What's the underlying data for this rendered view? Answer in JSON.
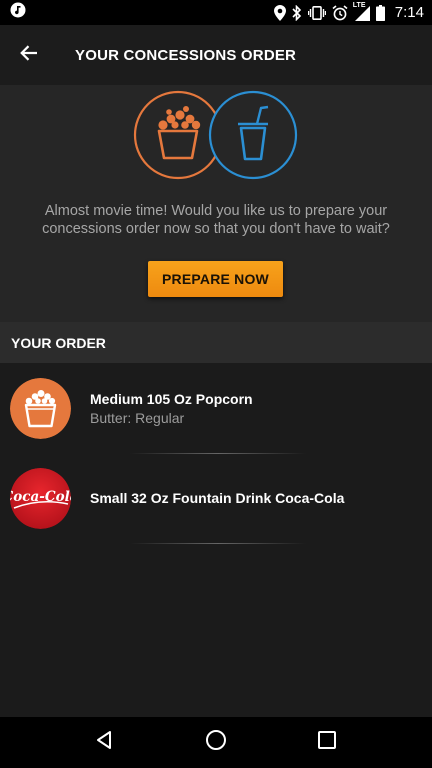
{
  "status_bar": {
    "time": "7:14",
    "network_label": "LTE",
    "icons": [
      "music-note-icon",
      "location-icon",
      "bluetooth-icon",
      "vibrate-icon",
      "alarm-icon",
      "signal-icon",
      "battery-icon"
    ]
  },
  "app_bar": {
    "back_icon": "arrow-back-icon",
    "title": "YOUR CONCESSIONS ORDER"
  },
  "hero": {
    "icons": [
      "popcorn-icon",
      "drink-icon"
    ],
    "message": "Almost movie time! Would you like us to prepare your concessions order now so that you don't have to wait?",
    "button_label": "PREPARE NOW"
  },
  "order": {
    "header": "YOUR ORDER",
    "items": [
      {
        "name": "Medium 105 Oz Popcorn",
        "detail": "Butter: Regular",
        "icon": "popcorn-icon"
      },
      {
        "name": "Small 32 Oz Fountain Drink Coca-Cola",
        "detail": "",
        "icon": "coca-cola-logo"
      }
    ],
    "logo_text": "Coca-Cola"
  },
  "nav_bar": {
    "buttons": [
      "back-triangle-icon",
      "home-circle-icon",
      "recents-square-icon"
    ]
  },
  "colors": {
    "accent_orange": "#f39a1c",
    "popcorn_orange": "#e5783d",
    "drink_blue": "#2b8fd3",
    "coke_red": "#d81f26",
    "background": "#1b1b1b",
    "hero_background": "#262626"
  }
}
